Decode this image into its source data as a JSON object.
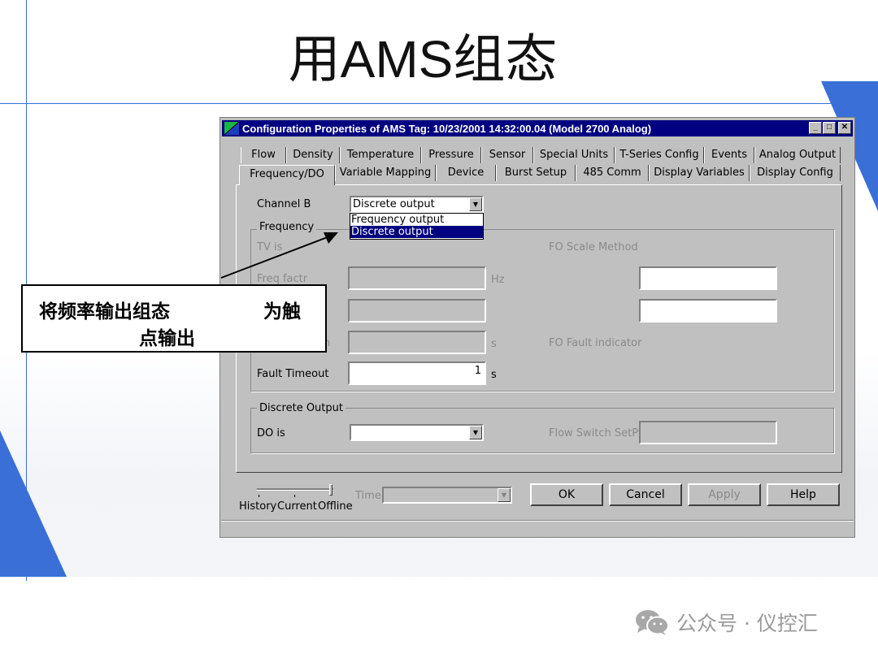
{
  "slide": {
    "title": "用AMS组态",
    "callout": {
      "line1_left": "将频率输出组态",
      "line1_right": "为触",
      "line2": "点输出"
    },
    "footer": "公众号 · 仪控汇"
  },
  "window": {
    "title": "Configuration Properties of AMS Tag: 10/23/2001 14:32:00.04 (Model 2700 Analog)",
    "controls": {
      "minimize": "_",
      "maximize": "□",
      "close": "✕"
    }
  },
  "tabs": {
    "row1": [
      "Flow",
      "Density",
      "Temperature",
      "Pressure",
      "Sensor",
      "Special Units",
      "T-Series Config",
      "Events",
      "Analog Output"
    ],
    "row2": [
      "Frequency/DO",
      "Variable Mapping",
      "Device",
      "Burst Setup",
      "485 Comm",
      "Display Variables",
      "Display Config"
    ],
    "active": "Frequency/DO"
  },
  "form": {
    "channel_b_label": "Channel B",
    "channel_b_value": "Discrete output",
    "dropdown_options": [
      "Frequency output",
      "Discrete output"
    ],
    "dropdown_selected": "Discrete output",
    "frequency_group": "Frequency",
    "tv_is_label": "TV is",
    "fo_scale_method_label": "FO Scale Method",
    "freq_factor_label": "Freq factr",
    "hz_unit": "Hz",
    "pulse_width_partial": "n",
    "s_unit": "s",
    "fo_fault_indicator_label": "FO Fault indicator",
    "fault_timeout_label": "Fault Timeout",
    "fault_timeout_value": "1",
    "fault_timeout_unit": "s",
    "discrete_output_group": "Discrete Output",
    "do_is_label": "DO is",
    "do_is_value": "",
    "flow_switch_label": "Flow Switch SetPt"
  },
  "bottom": {
    "slider_labels": [
      "History",
      "Current",
      "Offline"
    ],
    "time_label": "Time",
    "ok": "OK",
    "cancel": "Cancel",
    "apply": "Apply",
    "help": "Help"
  },
  "colors": {
    "title_bar": "#000080",
    "dialog_face": "#c0c0c0",
    "slide_accent": "#3a6fd8"
  }
}
